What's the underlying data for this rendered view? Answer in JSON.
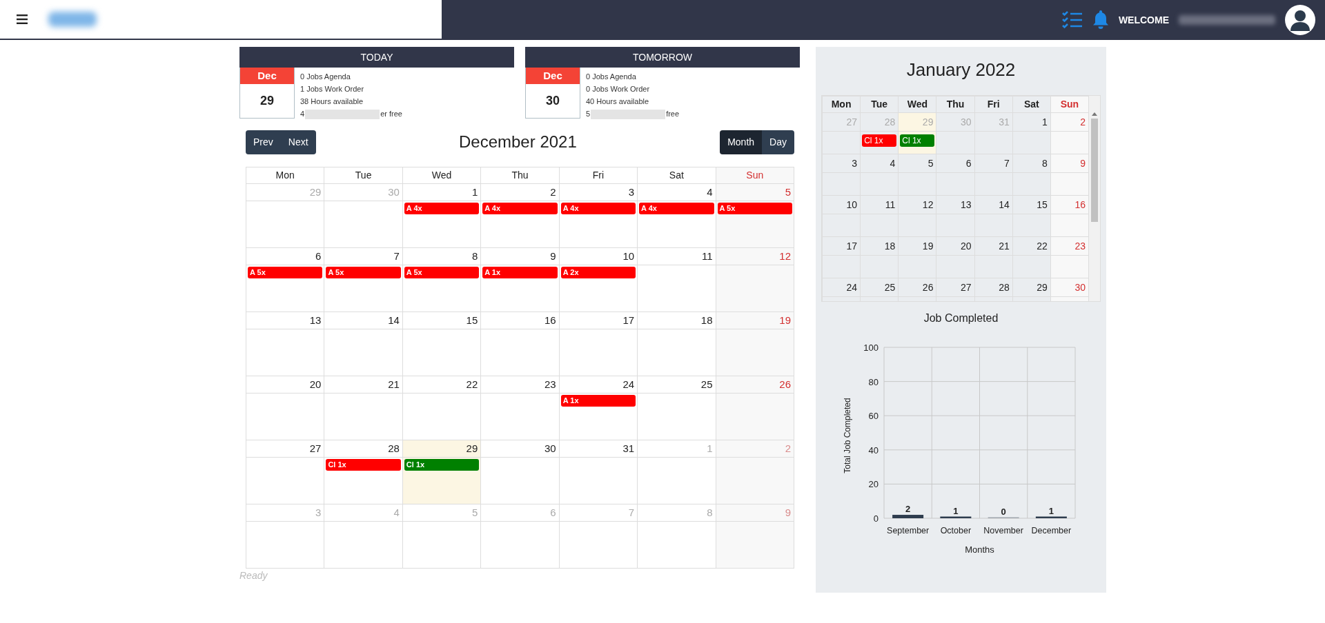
{
  "topbar": {
    "welcome": "WELCOME"
  },
  "day_cards": [
    {
      "title": "TODAY",
      "month": "Dec",
      "day": "29",
      "lines": [
        {
          "kind": "text",
          "text": "0 Jobs Agenda"
        },
        {
          "kind": "text",
          "text": "1 Jobs Work Order"
        },
        {
          "kind": "text",
          "text": "38 Hours available"
        },
        {
          "kind": "redacted",
          "prefix": "4",
          "suffix": "er free"
        }
      ]
    },
    {
      "title": "TOMORROW",
      "month": "Dec",
      "day": "30",
      "lines": [
        {
          "kind": "text",
          "text": "0 Jobs Agenda"
        },
        {
          "kind": "text",
          "text": "0 Jobs Work Order"
        },
        {
          "kind": "text",
          "text": "40 Hours available"
        },
        {
          "kind": "redacted",
          "prefix": "5",
          "suffix": "free"
        }
      ]
    }
  ],
  "calendar": {
    "nav_buttons": [
      "Prev",
      "Next"
    ],
    "title": "December 2021",
    "views": [
      {
        "label": "Month",
        "selected": true
      },
      {
        "label": "Day",
        "selected": false
      }
    ],
    "weekdays": [
      {
        "label": "Mon",
        "weekend": false
      },
      {
        "label": "Tue",
        "weekend": false
      },
      {
        "label": "Wed",
        "weekend": false
      },
      {
        "label": "Thu",
        "weekend": false
      },
      {
        "label": "Fri",
        "weekend": false
      },
      {
        "label": "Sat",
        "weekend": false
      },
      {
        "label": "Sun",
        "weekend": true
      }
    ],
    "weeks": [
      [
        {
          "day": "29",
          "outside": true,
          "today": false
        },
        {
          "day": "30",
          "outside": true,
          "today": false
        },
        {
          "day": "1",
          "outside": false,
          "today": false,
          "events": [
            {
              "label": "A 4x",
              "color": "#ff0000"
            }
          ]
        },
        {
          "day": "2",
          "outside": false,
          "today": false,
          "events": [
            {
              "label": "A 4x",
              "color": "#ff0000"
            }
          ]
        },
        {
          "day": "3",
          "outside": false,
          "today": false,
          "events": [
            {
              "label": "A 4x",
              "color": "#ff0000"
            }
          ]
        },
        {
          "day": "4",
          "outside": false,
          "today": false,
          "events": [
            {
              "label": "A 4x",
              "color": "#ff0000"
            }
          ]
        },
        {
          "day": "5",
          "outside": false,
          "today": false,
          "events": [
            {
              "label": "A 5x",
              "color": "#ff0000"
            }
          ]
        }
      ],
      [
        {
          "day": "6",
          "outside": false,
          "today": false,
          "events": [
            {
              "label": "A 5x",
              "color": "#ff0000"
            }
          ]
        },
        {
          "day": "7",
          "outside": false,
          "today": false,
          "events": [
            {
              "label": "A 5x",
              "color": "#ff0000"
            }
          ]
        },
        {
          "day": "8",
          "outside": false,
          "today": false,
          "events": [
            {
              "label": "A 5x",
              "color": "#ff0000"
            }
          ]
        },
        {
          "day": "9",
          "outside": false,
          "today": false,
          "events": [
            {
              "label": "A 1x",
              "color": "#ff0000"
            }
          ]
        },
        {
          "day": "10",
          "outside": false,
          "today": false,
          "events": [
            {
              "label": "A 2x",
              "color": "#ff0000"
            }
          ]
        },
        {
          "day": "11",
          "outside": false,
          "today": false
        },
        {
          "day": "12",
          "outside": false,
          "today": false
        }
      ],
      [
        {
          "day": "13",
          "outside": false,
          "today": false
        },
        {
          "day": "14",
          "outside": false,
          "today": false
        },
        {
          "day": "15",
          "outside": false,
          "today": false
        },
        {
          "day": "16",
          "outside": false,
          "today": false
        },
        {
          "day": "17",
          "outside": false,
          "today": false
        },
        {
          "day": "18",
          "outside": false,
          "today": false
        },
        {
          "day": "19",
          "outside": false,
          "today": false
        }
      ],
      [
        {
          "day": "20",
          "outside": false,
          "today": false
        },
        {
          "day": "21",
          "outside": false,
          "today": false
        },
        {
          "day": "22",
          "outside": false,
          "today": false
        },
        {
          "day": "23",
          "outside": false,
          "today": false
        },
        {
          "day": "24",
          "outside": false,
          "today": false,
          "events": [
            {
              "label": "A 1x",
              "color": "#ff0000"
            }
          ]
        },
        {
          "day": "25",
          "outside": false,
          "today": false
        },
        {
          "day": "26",
          "outside": false,
          "today": false
        }
      ],
      [
        {
          "day": "27",
          "outside": false,
          "today": false
        },
        {
          "day": "28",
          "outside": false,
          "today": false,
          "events": [
            {
              "label": "Cl 1x",
              "color": "#ff0000"
            }
          ]
        },
        {
          "day": "29",
          "outside": false,
          "today": true,
          "events": [
            {
              "label": "Cl 1x",
              "color": "#008000"
            }
          ]
        },
        {
          "day": "30",
          "outside": false,
          "today": false
        },
        {
          "day": "31",
          "outside": false,
          "today": false
        },
        {
          "day": "1",
          "outside": true,
          "today": false
        },
        {
          "day": "2",
          "outside": true,
          "today": false
        }
      ],
      [
        {
          "day": "3",
          "outside": true,
          "today": false
        },
        {
          "day": "4",
          "outside": true,
          "today": false
        },
        {
          "day": "5",
          "outside": true,
          "today": false
        },
        {
          "day": "6",
          "outside": true,
          "today": false
        },
        {
          "day": "7",
          "outside": true,
          "today": false
        },
        {
          "day": "8",
          "outside": true,
          "today": false
        },
        {
          "day": "9",
          "outside": true,
          "today": false
        }
      ]
    ],
    "status": "Ready"
  },
  "mini_calendar": {
    "title": "January 2022",
    "weekdays": [
      {
        "label": "Mon",
        "weekend": false
      },
      {
        "label": "Tue",
        "weekend": false
      },
      {
        "label": "Wed",
        "weekend": false
      },
      {
        "label": "Thu",
        "weekend": false
      },
      {
        "label": "Fri",
        "weekend": false
      },
      {
        "label": "Sat",
        "weekend": false
      },
      {
        "label": "Sun",
        "weekend": true
      }
    ],
    "weeks": [
      [
        {
          "day": "27",
          "outside": true,
          "today": false
        },
        {
          "day": "28",
          "outside": true,
          "today": false,
          "events": [
            {
              "label": "Cl 1x",
              "color": "#ff0000"
            }
          ]
        },
        {
          "day": "29",
          "outside": true,
          "today": true,
          "events": [
            {
              "label": "Cl 1x",
              "color": "#008000"
            }
          ]
        },
        {
          "day": "30",
          "outside": true,
          "today": false
        },
        {
          "day": "31",
          "outside": true,
          "today": false
        },
        {
          "day": "1",
          "outside": false,
          "today": false
        },
        {
          "day": "2",
          "outside": false,
          "today": false
        }
      ],
      [
        {
          "day": "3",
          "outside": false,
          "today": false
        },
        {
          "day": "4",
          "outside": false,
          "today": false
        },
        {
          "day": "5",
          "outside": false,
          "today": false
        },
        {
          "day": "6",
          "outside": false,
          "today": false
        },
        {
          "day": "7",
          "outside": false,
          "today": false
        },
        {
          "day": "8",
          "outside": false,
          "today": false
        },
        {
          "day": "9",
          "outside": false,
          "today": false
        }
      ],
      [
        {
          "day": "10",
          "outside": false,
          "today": false
        },
        {
          "day": "11",
          "outside": false,
          "today": false
        },
        {
          "day": "12",
          "outside": false,
          "today": false
        },
        {
          "day": "13",
          "outside": false,
          "today": false
        },
        {
          "day": "14",
          "outside": false,
          "today": false
        },
        {
          "day": "15",
          "outside": false,
          "today": false
        },
        {
          "day": "16",
          "outside": false,
          "today": false
        }
      ],
      [
        {
          "day": "17",
          "outside": false,
          "today": false
        },
        {
          "day": "18",
          "outside": false,
          "today": false
        },
        {
          "day": "19",
          "outside": false,
          "today": false
        },
        {
          "day": "20",
          "outside": false,
          "today": false
        },
        {
          "day": "21",
          "outside": false,
          "today": false
        },
        {
          "day": "22",
          "outside": false,
          "today": false
        },
        {
          "day": "23",
          "outside": false,
          "today": false
        }
      ],
      [
        {
          "day": "24",
          "outside": false,
          "today": false
        },
        {
          "day": "25",
          "outside": false,
          "today": false
        },
        {
          "day": "26",
          "outside": false,
          "today": false
        },
        {
          "day": "27",
          "outside": false,
          "today": false
        },
        {
          "day": "28",
          "outside": false,
          "today": false
        },
        {
          "day": "29",
          "outside": false,
          "today": false
        },
        {
          "day": "30",
          "outside": false,
          "today": false
        }
      ]
    ]
  },
  "job_chart": {
    "chart_data": {
      "type": "bar",
      "title": "Job Completed",
      "xlabel": "Months",
      "ylabel": "Total Job Completed",
      "categories": [
        "September",
        "October",
        "November",
        "December"
      ],
      "series": [
        {
          "color": "#2e3c4e",
          "values": [
            2,
            1,
            0,
            1
          ]
        }
      ],
      "ylim": [
        0,
        100
      ],
      "yticks": [
        0,
        20,
        40,
        60,
        80,
        100
      ],
      "grid": true,
      "data_labels": true
    }
  }
}
